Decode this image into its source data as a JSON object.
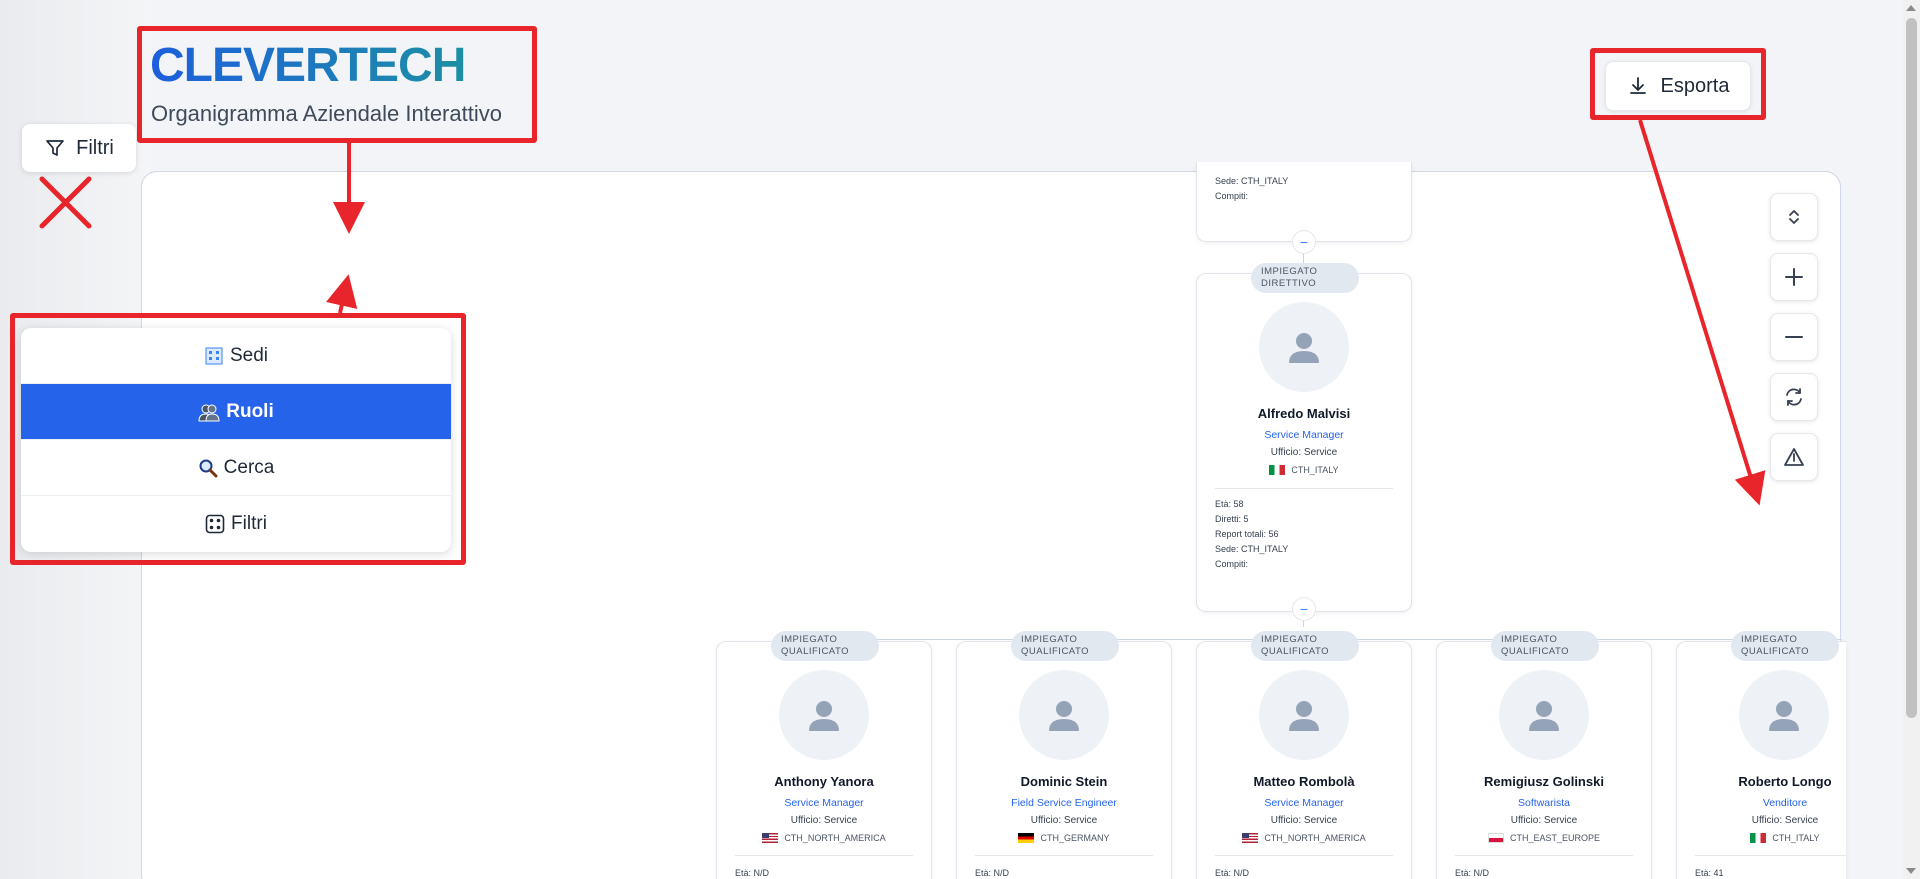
{
  "header": {
    "brand": "CLEVERTECH",
    "subtitle": "Organigramma Aziendale Interattivo",
    "filters_button": "Filtri",
    "export_button": "Esporta"
  },
  "menu": {
    "items": [
      {
        "label": "Sedi",
        "icon": "building-icon",
        "active": false
      },
      {
        "label": "Ruoli",
        "icon": "people-icon",
        "active": true
      },
      {
        "label": "Cerca",
        "icon": "magnifier-icon",
        "active": false
      },
      {
        "label": "Filtri",
        "icon": "dice-icon",
        "active": false
      }
    ]
  },
  "controls": [
    "expand-collapse-icon",
    "zoom-in-icon",
    "zoom-out-icon",
    "reset-icon",
    "warning-icon"
  ],
  "top_card_partial": {
    "sede_label": "Sede:",
    "sede": "CTH_ITALY",
    "compiti_label": "Compiti:"
  },
  "manager": {
    "badge": "IMPIEGATO DIRETTIVO",
    "name": "Alfredo Malvisi",
    "role": "Service Manager",
    "office": "Ufficio: Service",
    "site": "CTH_ITALY",
    "age": "Età: 58",
    "direct": "Diretti: 5",
    "reports": "Report totali: 56",
    "sede": "Sede: CTH_ITALY",
    "tasks": "Compiti:"
  },
  "employees": [
    {
      "badge": "IMPIEGATO QUALIFICATO",
      "name": "Anthony Yanora",
      "role": "Service Manager",
      "office": "Ufficio: Service",
      "site": "CTH_NORTH_AMERICA",
      "flag": "us",
      "age": "Età: N/D"
    },
    {
      "badge": "IMPIEGATO QUALIFICATO",
      "name": "Dominic Stein",
      "role": "Field Service Engineer",
      "office": "Ufficio: Service",
      "site": "CTH_GERMANY",
      "flag": "de",
      "age": "Età: N/D"
    },
    {
      "badge": "IMPIEGATO QUALIFICATO",
      "name": "Matteo Rombolà",
      "role": "Service Manager",
      "office": "Ufficio: Service",
      "site": "CTH_NORTH_AMERICA",
      "flag": "us",
      "age": "Età: N/D"
    },
    {
      "badge": "IMPIEGATO QUALIFICATO",
      "name": "Remigiusz Golinski",
      "role": "Softwarista",
      "office": "Ufficio: Service",
      "site": "CTH_EAST_EUROPE",
      "flag": "pl",
      "age": "Età: N/D"
    },
    {
      "badge": "IMPIEGATO QUALIFICATO",
      "name": "Roberto Longo",
      "role": "Venditore",
      "office": "Ufficio: Service",
      "site": "CTH_ITALY",
      "flag": "it",
      "age": "Età: 41"
    }
  ],
  "colors": {
    "accent": "#2563eb",
    "annotation": "#e8252a",
    "badge_bg": "#e2e8f0"
  }
}
